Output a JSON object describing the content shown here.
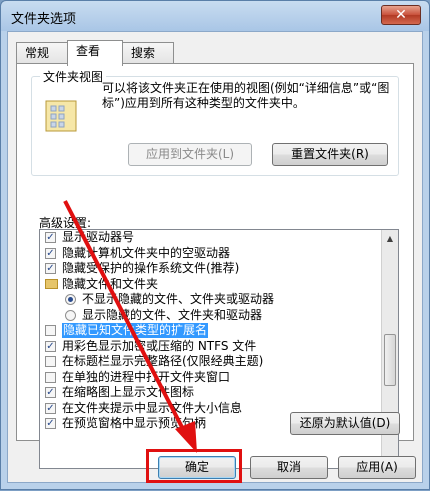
{
  "window": {
    "title": "文件夹选项",
    "close_label": "✕"
  },
  "tabs": [
    {
      "label": "常规"
    },
    {
      "label": "查看"
    },
    {
      "label": "搜索"
    }
  ],
  "folder_views": {
    "legend": "文件夹视图",
    "description": "可以将该文件夹正在使用的视图(例如“详细信息”或“图标”)应用到所有这种类型的文件夹中。",
    "apply_button": "应用到文件夹(L)",
    "reset_button": "重置文件夹(R)"
  },
  "advanced": {
    "label": "高级设置:",
    "items": [
      {
        "type": "checkbox",
        "checked": true,
        "indent": 0,
        "label": "显示驱动器号"
      },
      {
        "type": "checkbox",
        "checked": true,
        "indent": 0,
        "label": "隐藏计算机文件夹中的空驱动器"
      },
      {
        "type": "checkbox",
        "checked": true,
        "indent": 0,
        "label": "隐藏受保护的操作系统文件(推荐)"
      },
      {
        "type": "folder",
        "checked": false,
        "indent": 0,
        "label": "隐藏文件和文件夹"
      },
      {
        "type": "radio",
        "checked": true,
        "indent": 1,
        "label": "不显示隐藏的文件、文件夹或驱动器"
      },
      {
        "type": "radio",
        "checked": false,
        "indent": 1,
        "label": "显示隐藏的文件、文件夹和驱动器"
      },
      {
        "type": "checkbox",
        "checked": false,
        "indent": 0,
        "label": "隐藏已知文件类型的扩展名",
        "selected": true
      },
      {
        "type": "checkbox",
        "checked": true,
        "indent": 0,
        "label": "用彩色显示加密或压缩的 NTFS 文件"
      },
      {
        "type": "checkbox",
        "checked": false,
        "indent": 0,
        "label": "在标题栏显示完整路径(仅限经典主题)"
      },
      {
        "type": "checkbox",
        "checked": false,
        "indent": 0,
        "label": "在单独的进程中打开文件夹窗口"
      },
      {
        "type": "checkbox",
        "checked": true,
        "indent": 0,
        "label": "在缩略图上显示文件图标"
      },
      {
        "type": "checkbox",
        "checked": true,
        "indent": 0,
        "label": "在文件夹提示中显示文件大小信息"
      },
      {
        "type": "checkbox",
        "checked": true,
        "indent": 0,
        "label": "在预览窗格中显示预览句柄"
      }
    ],
    "restore_button": "还原为默认值(D)"
  },
  "footer": {
    "ok_button": "确定",
    "cancel_button": "取消",
    "apply_button": "应用(A)"
  },
  "colors": {
    "highlight": "#3399ff",
    "annotation_red": "#e01010"
  }
}
